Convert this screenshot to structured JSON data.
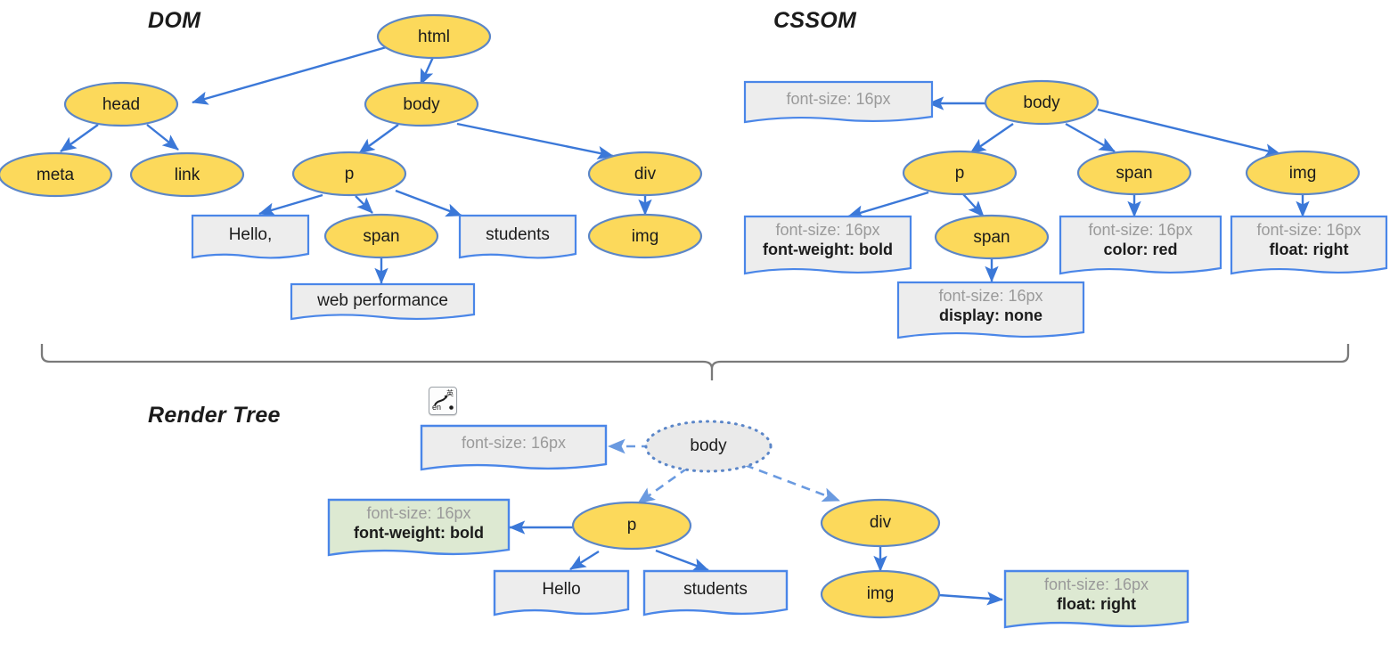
{
  "diagram": {
    "titles": {
      "dom": "DOM",
      "cssom": "CSSOM",
      "render_tree": "Render Tree"
    },
    "colors": {
      "node_fill": "#FCD95B",
      "node_stroke": "#5B86C8",
      "box_fill": "#EDEDED",
      "box_fill_green": "#DDE9D2",
      "box_stroke": "#4A86E8",
      "edge": "#3B78D8",
      "text_muted": "#9a9a9a",
      "text_dark": "#1b1b1b",
      "brace": "#7a7a7a",
      "render_body_fill": "#EAEAEA"
    }
  },
  "dom": {
    "nodes": [
      {
        "id": "html",
        "label": "html",
        "type": "ellipse"
      },
      {
        "id": "head",
        "label": "head",
        "type": "ellipse"
      },
      {
        "id": "body",
        "label": "body",
        "type": "ellipse"
      },
      {
        "id": "meta",
        "label": "meta",
        "type": "ellipse"
      },
      {
        "id": "link",
        "label": "link",
        "type": "ellipse"
      },
      {
        "id": "p",
        "label": "p",
        "type": "ellipse"
      },
      {
        "id": "div",
        "label": "div",
        "type": "ellipse"
      },
      {
        "id": "span",
        "label": "span",
        "type": "ellipse"
      },
      {
        "id": "img",
        "label": "img",
        "type": "ellipse"
      },
      {
        "id": "hello",
        "label": "Hello,",
        "type": "box"
      },
      {
        "id": "students",
        "label": "students",
        "type": "box"
      },
      {
        "id": "webperf",
        "label": "web performance",
        "type": "box"
      }
    ],
    "edges": [
      [
        "html",
        "head"
      ],
      [
        "html",
        "body"
      ],
      [
        "head",
        "meta"
      ],
      [
        "head",
        "link"
      ],
      [
        "body",
        "p"
      ],
      [
        "body",
        "div"
      ],
      [
        "p",
        "hello"
      ],
      [
        "p",
        "span"
      ],
      [
        "p",
        "students"
      ],
      [
        "div",
        "img"
      ],
      [
        "span",
        "webperf"
      ]
    ]
  },
  "cssom": {
    "nodes": [
      {
        "id": "body",
        "label": "body",
        "type": "ellipse"
      },
      {
        "id": "p",
        "label": "p",
        "type": "ellipse"
      },
      {
        "id": "span_top",
        "label": "span",
        "type": "ellipse"
      },
      {
        "id": "img",
        "label": "img",
        "type": "ellipse"
      },
      {
        "id": "span_child",
        "label": "span",
        "type": "ellipse"
      }
    ],
    "rules": [
      {
        "id": "body_rule",
        "line1": "font-size: 16px",
        "line2": ""
      },
      {
        "id": "p_rule",
        "line1": "font-size: 16px",
        "line2": "font-weight: bold"
      },
      {
        "id": "span_child_rule",
        "line1": "font-size: 16px",
        "line2": "display: none"
      },
      {
        "id": "span_top_rule",
        "line1": "font-size: 16px",
        "line2": "color: red"
      },
      {
        "id": "img_rule",
        "line1": "font-size: 16px",
        "line2": "float: right"
      }
    ],
    "edges": [
      [
        "body",
        "body_rule"
      ],
      [
        "body",
        "p"
      ],
      [
        "body",
        "span_top"
      ],
      [
        "body",
        "img"
      ],
      [
        "p",
        "p_rule"
      ],
      [
        "p",
        "span_child"
      ],
      [
        "span_child",
        "span_child_rule"
      ],
      [
        "span_top",
        "span_top_rule"
      ],
      [
        "img",
        "img_rule"
      ]
    ]
  },
  "render_tree": {
    "nodes": [
      {
        "id": "body",
        "label": "body",
        "type": "ellipse-dotted"
      },
      {
        "id": "p",
        "label": "p",
        "type": "ellipse"
      },
      {
        "id": "div",
        "label": "div",
        "type": "ellipse"
      },
      {
        "id": "img",
        "label": "img",
        "type": "ellipse"
      }
    ],
    "boxes": [
      {
        "id": "body_rule",
        "line1": "font-size: 16px",
        "line2": "",
        "fill": "gray"
      },
      {
        "id": "p_rule",
        "line1": "font-size: 16px",
        "line2": "font-weight: bold",
        "fill": "green"
      },
      {
        "id": "img_rule",
        "line1": "font-size: 16px",
        "line2": "float: right",
        "fill": "green"
      },
      {
        "id": "hello",
        "line1": "Hello",
        "line2": "",
        "fill": "gray"
      },
      {
        "id": "students",
        "line1": "students",
        "line2": "",
        "fill": "gray"
      }
    ],
    "edges": [
      [
        "body",
        "body_rule",
        "dashed"
      ],
      [
        "body",
        "p",
        "dashed"
      ],
      [
        "body",
        "div",
        "dashed"
      ],
      [
        "p",
        "p_rule",
        "solid"
      ],
      [
        "p",
        "hello",
        "solid"
      ],
      [
        "p",
        "students",
        "solid"
      ],
      [
        "div",
        "img",
        "solid"
      ],
      [
        "img",
        "img_rule",
        "solid"
      ]
    ]
  },
  "ime_icon": {
    "name": "ime-language-indicator",
    "label_en": "en",
    "label_cjk": "英"
  }
}
